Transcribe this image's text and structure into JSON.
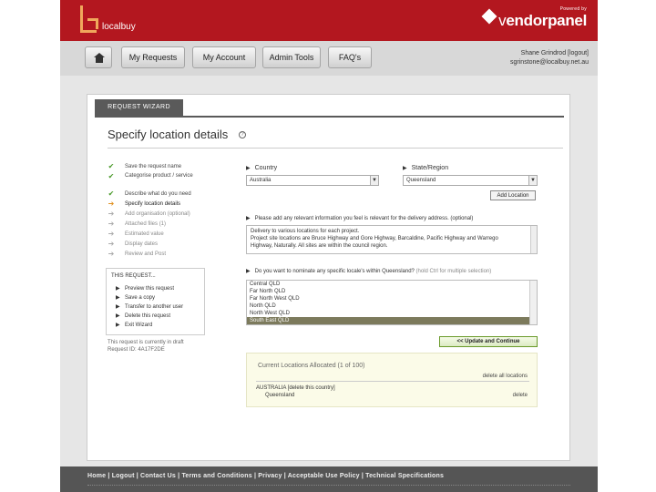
{
  "header": {
    "logo_text": "localbuy",
    "powered_by": "Powered by",
    "brand_v": "v",
    "brand_rest": "endorpanel"
  },
  "nav": {
    "home_icon": "home-icon",
    "items": [
      "My Requests",
      "My Account",
      "Admin Tools",
      "FAQ's"
    ]
  },
  "user": {
    "line1": "Shane Grindrod [logout]",
    "line2": "sgrinstone@localbuy.net.au"
  },
  "wizard": {
    "tab_label": "REQUEST WIZARD",
    "page_title": "Specify location details"
  },
  "steps": [
    {
      "label": "Save the request name",
      "status": "done"
    },
    {
      "label": "Categorise product / service",
      "status": "done"
    },
    {
      "label": "Describe what do you need",
      "status": "done"
    },
    {
      "label": "Specify location details",
      "status": "current"
    },
    {
      "label": "Add organisation (optional)",
      "status": "pending"
    },
    {
      "label": "Attached files (1)",
      "status": "pending"
    },
    {
      "label": "Estimated value",
      "status": "pending"
    },
    {
      "label": "Display dates",
      "status": "pending"
    },
    {
      "label": "Review and Post",
      "status": "pending"
    }
  ],
  "this_request": {
    "title": "THIS REQUEST...",
    "items": [
      "Preview this request",
      "Save a copy",
      "Transfer to another user",
      "Delete this request",
      "Exit Wizard"
    ],
    "note_line1": "This request is currently in draft",
    "note_line2": "Request ID: 4A17F2DE"
  },
  "form": {
    "country_label": "Country",
    "country_value": "Australia",
    "state_label": "State/Region",
    "state_value": "Queensland",
    "add_location": "Add Location",
    "reason_label": "Please add any relevant information you feel is relevant for the delivery address. (optional)",
    "reason_line1": "Delivery to various locations for each project.",
    "reason_line2": "Project site locations are Bruce Highway and Gore Highway, Barcaldine, Pacific Highway and Warrego",
    "reason_line3": "Highway, Naturally. All sites are within the council region.",
    "region_label": "Do you want to nominate any specific locale's within Queensland?",
    "region_hint": "(hold Ctrl for multiple selection)",
    "regions": [
      "Central QLD",
      "Far North QLD",
      "Far North West QLD",
      "North QLD",
      "North West QLD",
      "South East QLD"
    ],
    "add_continue": "<< Update and Continue"
  },
  "allocations": {
    "title": "Current Locations Allocated (1 of 100)",
    "delete_all": "delete all locations",
    "country": "AUSTRALIA [delete this country]",
    "state": "Queensland",
    "delete": "delete"
  },
  "footer": {
    "links": "Home | Logout | Contact Us | Terms and Conditions | Privacy | Acceptable Use Policy | Technical Specifications"
  }
}
